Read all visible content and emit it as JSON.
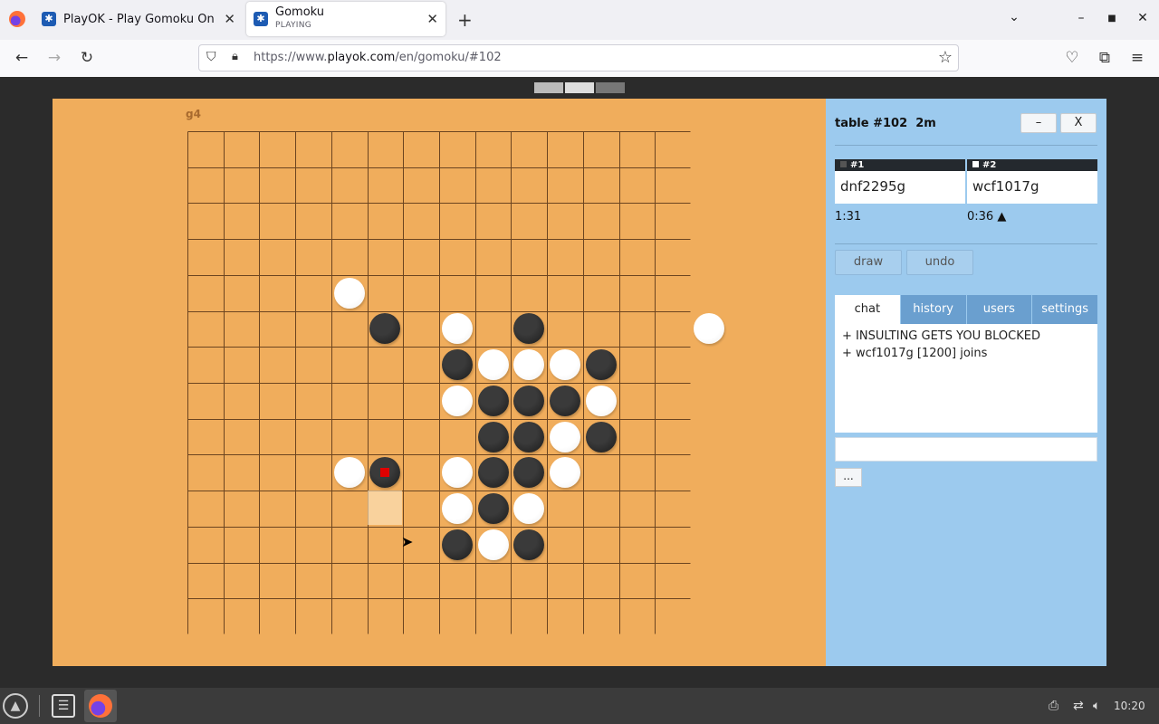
{
  "browser": {
    "tabs": [
      {
        "title": "PlayOK - Play Gomoku Online",
        "subtitle": "",
        "active": false
      },
      {
        "title": "Gomoku",
        "subtitle": "PLAYING",
        "active": true
      }
    ],
    "new_tab_label": "+",
    "url_prefix": "https://www.",
    "url_domain": "playok.com",
    "url_path": "/en/gomoku/#102"
  },
  "game": {
    "coord_label": "g4",
    "board_size": 15,
    "last_move": {
      "col": 6,
      "row": 10
    },
    "hover_cell": {
      "col": 6,
      "row": 11
    },
    "white_stones": [
      [
        5,
        5
      ],
      [
        8,
        6
      ],
      [
        15,
        6
      ],
      [
        9,
        7
      ],
      [
        10,
        7
      ],
      [
        11,
        7
      ],
      [
        8,
        8
      ],
      [
        12,
        8
      ],
      [
        11,
        9
      ],
      [
        5,
        10
      ],
      [
        8,
        10
      ],
      [
        11,
        10
      ],
      [
        8,
        11
      ],
      [
        10,
        11
      ],
      [
        9,
        12
      ]
    ],
    "black_stones": [
      [
        6,
        6
      ],
      [
        10,
        6
      ],
      [
        8,
        7
      ],
      [
        12,
        7
      ],
      [
        9,
        8
      ],
      [
        10,
        8
      ],
      [
        11,
        8
      ],
      [
        9,
        9
      ],
      [
        10,
        9
      ],
      [
        12,
        9
      ],
      [
        6,
        10
      ],
      [
        9,
        10
      ],
      [
        10,
        10
      ],
      [
        9,
        11
      ],
      [
        8,
        12
      ],
      [
        10,
        12
      ]
    ]
  },
  "panel": {
    "table_label": "table #102",
    "table_time": "2m",
    "minimize_label": "–",
    "close_label": "X",
    "players": [
      {
        "seat": "#1",
        "name": "dnf2295g",
        "time": "1:31",
        "seat_color": "#555555"
      },
      {
        "seat": "#2",
        "name": "wcf1017g",
        "time": "0:36  ▲",
        "seat_color": "#ffffff"
      }
    ],
    "draw_label": "draw",
    "undo_label": "undo",
    "tabs": [
      "chat",
      "history",
      "users",
      "settings"
    ],
    "chat_lines": [
      "+ INSULTING GETS YOU BLOCKED",
      "+ wcf1017g [1200] joins"
    ],
    "more_label": "..."
  },
  "taskbar": {
    "clock": "10:20"
  },
  "colors": {
    "board": "#f0ad5c",
    "panel": "#9ccaee",
    "grid": "#6b4420"
  }
}
